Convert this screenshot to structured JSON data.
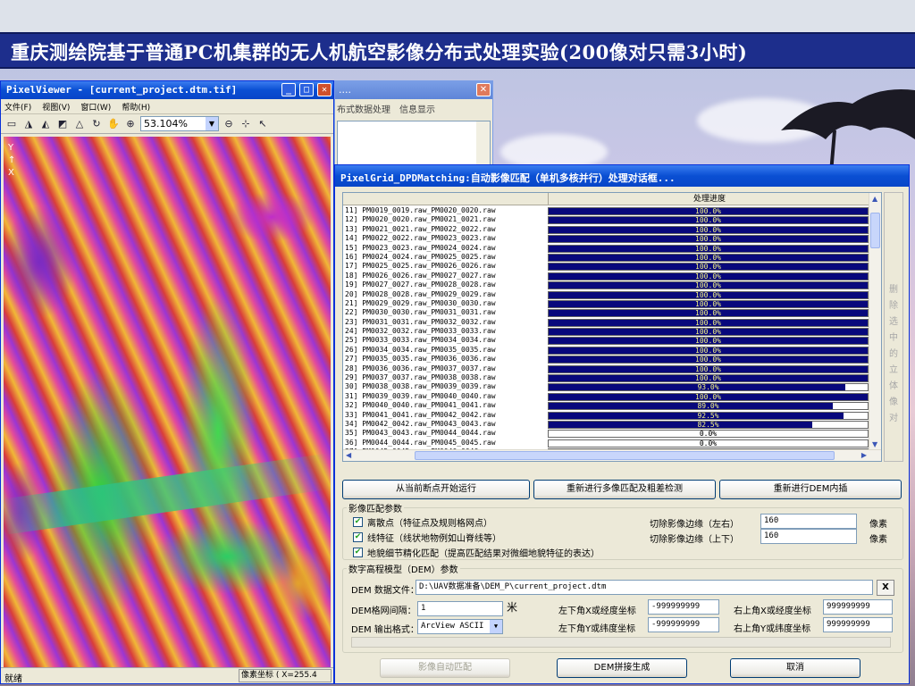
{
  "slide": {
    "title": "重庆测绘院基于普通PC机集群的无人机航空影像分布式处理实验(200像对只需3小时)"
  },
  "pixelviewer": {
    "title": "PixelViewer - [current_project.dtm.tif]",
    "menu": [
      "文件(F)",
      "视图(V)",
      "窗口(W)",
      "帮助(H)"
    ],
    "zoom": "53.104%",
    "axis_y": "Y",
    "axis_x": "X",
    "status_left": "就绪",
    "status_right": "像素坐标 ( X=255.4"
  },
  "bg_window": {
    "title": "....",
    "menu": [
      "布式数据处理",
      "信息显示"
    ]
  },
  "dialog": {
    "title": "PixelGrid_DPDMatching:自动影像匹配（单机多核并行）处理对话框...",
    "progress_header": "处理进度",
    "rows": [
      {
        "name": "11] PM0019_0019.raw_PM0020_0020.raw",
        "pct_label": "100.0%",
        "pct": 100
      },
      {
        "name": "12] PM0020_0020.raw_PM0021_0021.raw",
        "pct_label": "100.0%",
        "pct": 100
      },
      {
        "name": "13] PM0021_0021.raw_PM0022_0022.raw",
        "pct_label": "100.0%",
        "pct": 100
      },
      {
        "name": "14] PM0022_0022.raw_PM0023_0023.raw",
        "pct_label": "100.0%",
        "pct": 100
      },
      {
        "name": "15] PM0023_0023.raw_PM0024_0024.raw",
        "pct_label": "100.0%",
        "pct": 100
      },
      {
        "name": "16] PM0024_0024.raw_PM0025_0025.raw",
        "pct_label": "100.0%",
        "pct": 100
      },
      {
        "name": "17] PM0025_0025.raw_PM0026_0026.raw",
        "pct_label": "100.0%",
        "pct": 100
      },
      {
        "name": "18] PM0026_0026.raw_PM0027_0027.raw",
        "pct_label": "100.0%",
        "pct": 100
      },
      {
        "name": "19] PM0027_0027.raw_PM0028_0028.raw",
        "pct_label": "100.0%",
        "pct": 100
      },
      {
        "name": "20] PM0028_0028.raw_PM0029_0029.raw",
        "pct_label": "100.0%",
        "pct": 100
      },
      {
        "name": "21] PM0029_0029.raw_PM0030_0030.raw",
        "pct_label": "100.0%",
        "pct": 100
      },
      {
        "name": "22] PM0030_0030.raw_PM0031_0031.raw",
        "pct_label": "100.0%",
        "pct": 100
      },
      {
        "name": "23] PM0031_0031.raw_PM0032_0032.raw",
        "pct_label": "100.0%",
        "pct": 100
      },
      {
        "name": "24] PM0032_0032.raw_PM0033_0033.raw",
        "pct_label": "100.0%",
        "pct": 100
      },
      {
        "name": "25] PM0033_0033.raw_PM0034_0034.raw",
        "pct_label": "100.0%",
        "pct": 100
      },
      {
        "name": "26] PM0034_0034.raw_PM0035_0035.raw",
        "pct_label": "100.0%",
        "pct": 100
      },
      {
        "name": "27] PM0035_0035.raw_PM0036_0036.raw",
        "pct_label": "100.0%",
        "pct": 100
      },
      {
        "name": "28] PM0036_0036.raw_PM0037_0037.raw",
        "pct_label": "100.0%",
        "pct": 100
      },
      {
        "name": "29] PM0037_0037.raw_PM0038_0038.raw",
        "pct_label": "100.0%",
        "pct": 100
      },
      {
        "name": "30] PM0038_0038.raw_PM0039_0039.raw",
        "pct_label": "93.0%",
        "pct": 93
      },
      {
        "name": "31] PM0039_0039.raw_PM0040_0040.raw",
        "pct_label": "100.0%",
        "pct": 100
      },
      {
        "name": "32] PM0040_0040.raw_PM0041_0041.raw",
        "pct_label": "89.0%",
        "pct": 89
      },
      {
        "name": "33] PM0041_0041.raw_PM0042_0042.raw",
        "pct_label": "92.5%",
        "pct": 92.5
      },
      {
        "name": "34] PM0042_0042.raw_PM0043_0043.raw",
        "pct_label": "82.5%",
        "pct": 82.5
      },
      {
        "name": "35] PM0043_0043.raw_PM0044_0044.raw",
        "pct_label": "0.0%",
        "pct": 0
      },
      {
        "name": "36] PM0044_0044.raw_PM0045_0045.raw",
        "pct_label": "0.0%",
        "pct": 0
      },
      {
        "name": "37] PM0045_0045.raw_PM0046_0046.raw",
        "pct_label": "0.0%",
        "pct": 0
      }
    ],
    "delete_label": "删除选中的立体像对",
    "btn_resume": "从当前断点开始运行",
    "btn_rematch": "重新进行多像匹配及粗差检测",
    "btn_reinterp": "重新进行DEM内插",
    "group_match": "影像匹配参数",
    "chk_points": "离散点（特征点及规则格网点）",
    "chk_lines": "线特征（线状地物例如山脊线等）",
    "chk_refine": "地貌细节精化匹配（提高匹配结果对微细地貌特征的表达）",
    "crop_lr_label": "切除影像边缘（左右）",
    "crop_lr_value": "160",
    "crop_ud_label": "切除影像边缘（上下）",
    "crop_ud_value": "160",
    "unit1": "像素",
    "unit2": "像素",
    "group_dem": "数字高程模型（DEM）参数",
    "dem_file_label": "DEM 数据文件：",
    "dem_file_value": "D:\\UAV数据准备\\DEM_P\\current_project.dtm",
    "clear_btn": "X",
    "grid_label": "DEM格网间隔：",
    "grid_value": "1",
    "grid_unit": "米",
    "fmt_label": "DEM 输出格式：",
    "fmt_value": "ArcView ASCII",
    "ll_x_label": "左下角X或经度坐标",
    "ll_x_value": "-999999999",
    "ll_y_label": "左下角Y或纬度坐标",
    "ll_y_value": "-999999999",
    "ur_x_label": "右上角X或经度坐标",
    "ur_x_value": "999999999",
    "ur_y_label": "右上角Y或纬度坐标",
    "ur_y_value": "999999999",
    "btn_auto": "影像自动匹配",
    "btn_mosaic": "DEM拼接生成",
    "btn_cancel": "取消"
  }
}
